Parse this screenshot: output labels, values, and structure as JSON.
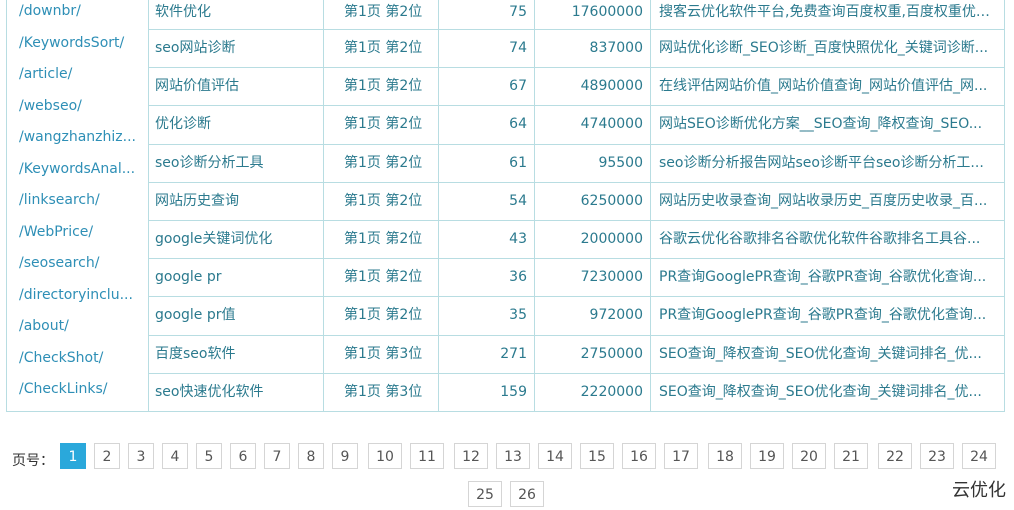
{
  "paths": [
    "/downbr/",
    "/KeywordsSort/",
    "/article/",
    "/webseo/",
    "/wangzhanzhiz...",
    "/KeywordsAnal...",
    "/linksearch/",
    "/WebPrice/",
    "/seosearch/",
    "/directoryinclu...",
    "/about/",
    "/CheckShot/",
    "/CheckLinks/"
  ],
  "rows": [
    {
      "keyword": "软件优化",
      "rank": "第1页 第2位",
      "index": "75",
      "results": "17600000",
      "title": "搜客云优化软件平台,免费查询百度权重,百度权重优化..."
    },
    {
      "keyword": "seo网站诊断",
      "rank": "第1页 第2位",
      "index": "74",
      "results": "837000",
      "title": "网站优化诊断_SEO诊断_百度快照优化_关键词诊断..."
    },
    {
      "keyword": "网站价值评估",
      "rank": "第1页 第2位",
      "index": "67",
      "results": "4890000",
      "title": "在线评估网站价值_网站价值查询_网站价值评估_网..."
    },
    {
      "keyword": "优化诊断",
      "rank": "第1页 第2位",
      "index": "64",
      "results": "4740000",
      "title": "网站SEO诊断优化方案__SEO查询_降权查询_SEO..."
    },
    {
      "keyword": "seo诊断分析工具",
      "rank": "第1页 第2位",
      "index": "61",
      "results": "95500",
      "title": "seo诊断分析报告网站seo诊断平台seo诊断分析工..."
    },
    {
      "keyword": "网站历史查询",
      "rank": "第1页 第2位",
      "index": "54",
      "results": "6250000",
      "title": "网站历史收录查询_网站收录历史_百度历史收录_百..."
    },
    {
      "keyword": "google关键词优化",
      "rank": "第1页 第2位",
      "index": "43",
      "results": "2000000",
      "title": "谷歌云优化谷歌排名谷歌优化软件谷歌排名工具谷..."
    },
    {
      "keyword": "google pr",
      "rank": "第1页 第2位",
      "index": "36",
      "results": "7230000",
      "title": "PR查询GooglePR查询_谷歌PR查询_谷歌优化查询..."
    },
    {
      "keyword": "google pr值",
      "rank": "第1页 第2位",
      "index": "35",
      "results": "972000",
      "title": "PR查询GooglePR查询_谷歌PR查询_谷歌优化查询..."
    },
    {
      "keyword": "百度seo软件",
      "rank": "第1页 第3位",
      "index": "271",
      "results": "2750000",
      "title": "SEO查询_降权查询_SEO优化查询_关键词排名_优..."
    },
    {
      "keyword": "seo快速优化软件",
      "rank": "第1页 第3位",
      "index": "159",
      "results": "2220000",
      "title": "SEO查询_降权查询_SEO优化查询_关键词排名_优..."
    }
  ],
  "pager": {
    "label": "页号：",
    "active": "1",
    "pages": [
      "1",
      "2",
      "3",
      "4",
      "5",
      "6",
      "7",
      "8",
      "9",
      "10",
      "11",
      "12",
      "13",
      "14",
      "15",
      "16",
      "17",
      "18",
      "19",
      "20",
      "21",
      "22",
      "23",
      "24",
      "25",
      "26"
    ]
  },
  "brand": "云优化"
}
